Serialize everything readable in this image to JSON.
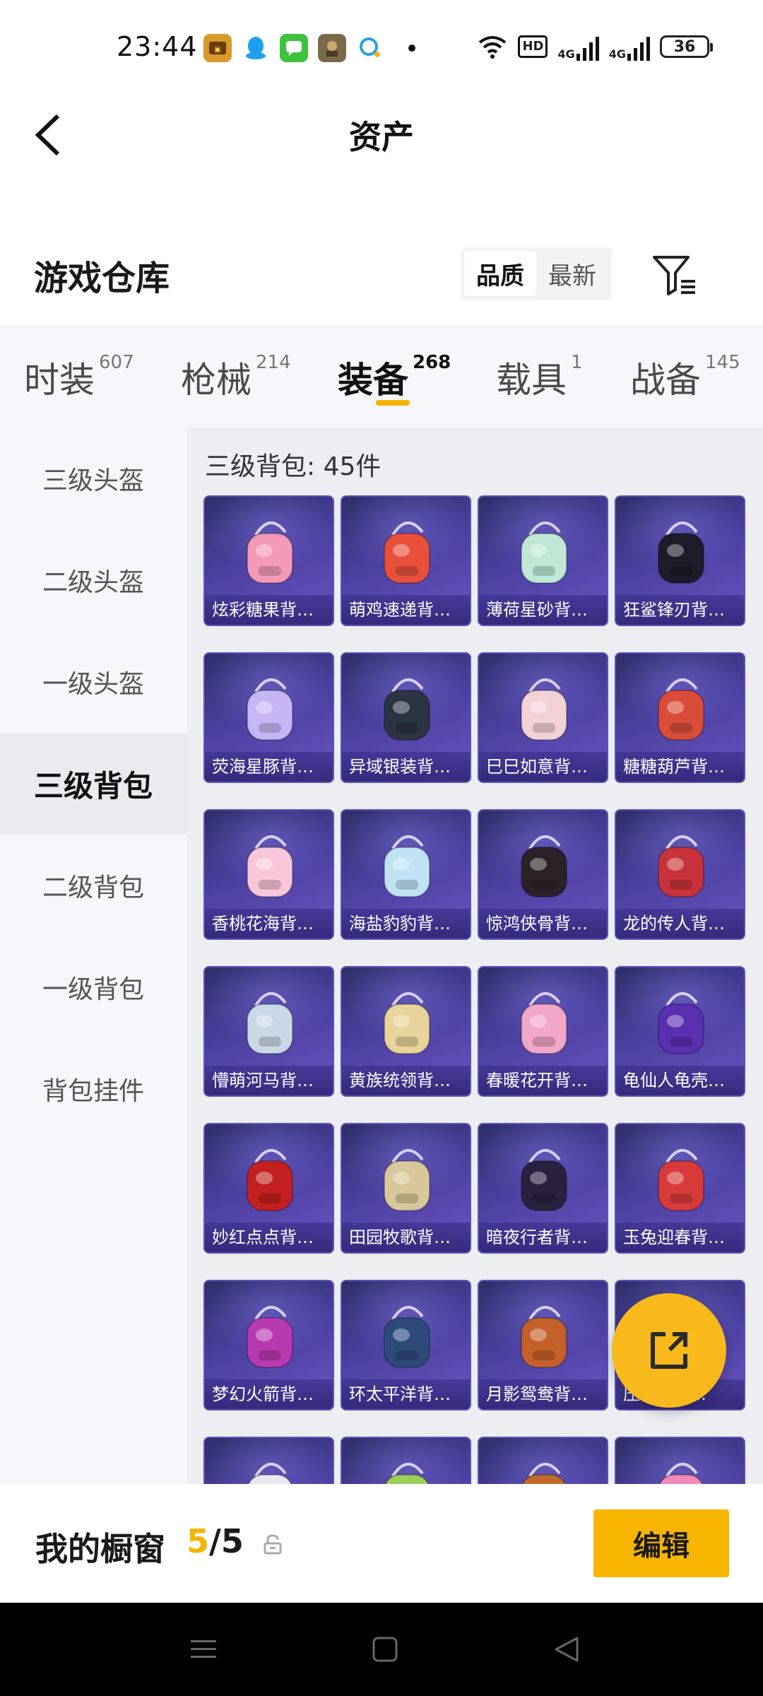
{
  "status_bar": {
    "time": "23:44",
    "app_icons": [
      "game-center-icon",
      "qq-icon",
      "messages-icon",
      "pubg-icon",
      "chat-bubble-icon"
    ],
    "network_labels": [
      "HD",
      "4G",
      "4G"
    ],
    "battery": "36"
  },
  "header": {
    "title": "资产",
    "back_icon": "chevron-left-icon"
  },
  "warehouse": {
    "title": "游戏仓库",
    "sort_options": [
      "品质",
      "最新"
    ],
    "active_sort": "品质",
    "filter_icon": "filter-icon"
  },
  "tabs": [
    {
      "label": "时装",
      "count": "607"
    },
    {
      "label": "枪械",
      "count": "214"
    },
    {
      "label": "装备",
      "count": "268"
    },
    {
      "label": "载具",
      "count": "1"
    },
    {
      "label": "战备",
      "count": "145"
    }
  ],
  "active_tab": "装备",
  "sidebar": {
    "items": [
      "三级头盔",
      "二级头盔",
      "一级头盔",
      "三级背包",
      "二级背包",
      "一级背包",
      "背包挂件"
    ],
    "active": "三级背包"
  },
  "section": {
    "title": "三级背包: 45件"
  },
  "items": [
    "炫彩糖果背包...",
    "萌鸡速递背包...",
    "薄荷星砂背包...",
    "狂鲨锋刃背包...",
    "荧海星豚背包...",
    "异域银装背包...",
    "巳巳如意背包...",
    "糖糖葫芦背包...",
    "香桃花海背包...",
    "海盐豹豹背包...",
    "惊鸿侠骨背包...",
    "龙的传人背包...",
    "懵萌河马背包...",
    "黄族统领背包...",
    "春暖花开背包...",
    "龟仙人龟壳背...",
    "妙红点点背包...",
    "田园牧歌背包...",
    "暗夜行者背包...",
    "玉兔迎春背包...",
    "梦幻火箭背包...",
    "环太平洋背包...",
    "月影鸳鸯背包...",
    "压...背包...",
    "",
    "",
    "",
    ""
  ],
  "item_art_colors": [
    "#f29ab8",
    "#e8503a",
    "#bfe7d6",
    "#1c1c2a",
    "#c7b6f5",
    "#2b3442",
    "#f3d2d6",
    "#d94c3a",
    "#f7c6d8",
    "#bfe3f5",
    "#2a2226",
    "#c8323a",
    "#c9d8e6",
    "#e8d39a",
    "#f2a6c8",
    "#5a2fb0",
    "#c42020",
    "#d8c79a",
    "#2a2040",
    "#d83a3a",
    "#b83ab0",
    "#2e4a7a",
    "#c4602a",
    "#ffffff",
    "#e8e8f0",
    "#9ad05a",
    "#c06a2a",
    "#f08ab8"
  ],
  "fab": {
    "icon": "share-icon"
  },
  "showcase": {
    "label": "我的橱窗",
    "count_used": "5",
    "count_sep": "/",
    "count_total": "5",
    "lock_icon": "lock-icon",
    "edit_label": "编辑"
  },
  "nav": [
    "menu-icon",
    "home-icon",
    "back-triangle-icon"
  ],
  "colors": {
    "accent": "#f5b400",
    "card_bg": "#4a3f9e",
    "panel_bg": "#eceef2"
  }
}
